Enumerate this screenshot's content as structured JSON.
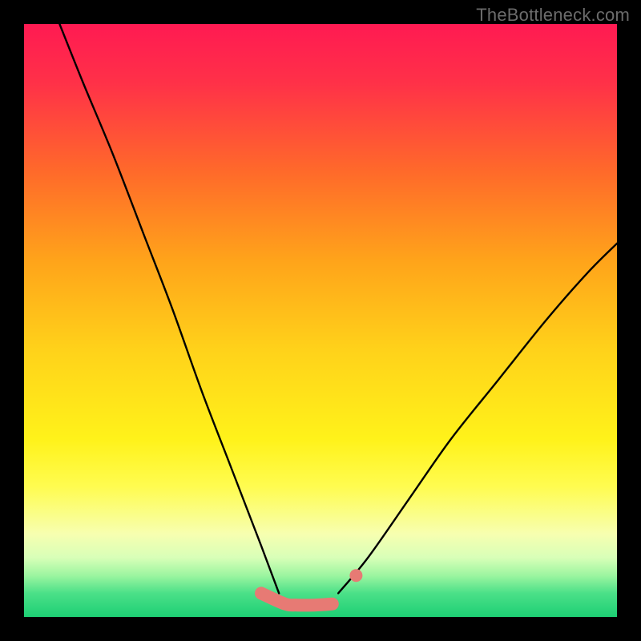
{
  "watermark": {
    "text": "TheBottleneck.com"
  },
  "chart_data": {
    "type": "line",
    "title": "",
    "xlabel": "",
    "ylabel": "",
    "xlim": [
      0,
      100
    ],
    "ylim": [
      0,
      100
    ],
    "grid": false,
    "legend": false,
    "series": [
      {
        "name": "left-curve",
        "x": [
          6,
          10,
          15,
          20,
          25,
          30,
          35,
          40,
          43
        ],
        "y": [
          100,
          90,
          78,
          65,
          52,
          38,
          25,
          12,
          4
        ]
      },
      {
        "name": "right-curve",
        "x": [
          53,
          58,
          65,
          72,
          80,
          88,
          95,
          100
        ],
        "y": [
          4,
          10,
          20,
          30,
          40,
          50,
          58,
          63
        ]
      },
      {
        "name": "floor-marker",
        "x": [
          40,
          44,
          46,
          49,
          52,
          56
        ],
        "y": [
          4,
          2.2,
          2,
          2,
          2.2,
          7
        ]
      }
    ],
    "background_gradient_stops": [
      {
        "offset": 0.0,
        "color": "#ff1a52"
      },
      {
        "offset": 0.1,
        "color": "#ff3148"
      },
      {
        "offset": 0.25,
        "color": "#ff6a2a"
      },
      {
        "offset": 0.4,
        "color": "#ffa41a"
      },
      {
        "offset": 0.55,
        "color": "#ffd21a"
      },
      {
        "offset": 0.7,
        "color": "#fff21a"
      },
      {
        "offset": 0.78,
        "color": "#fffc50"
      },
      {
        "offset": 0.86,
        "color": "#f7ffb0"
      },
      {
        "offset": 0.9,
        "color": "#d8ffb8"
      },
      {
        "offset": 0.93,
        "color": "#9cf5a0"
      },
      {
        "offset": 0.96,
        "color": "#4be088"
      },
      {
        "offset": 1.0,
        "color": "#1dcf74"
      }
    ],
    "floor_marker_color": "#e77a74",
    "curve_color": "#000000"
  }
}
